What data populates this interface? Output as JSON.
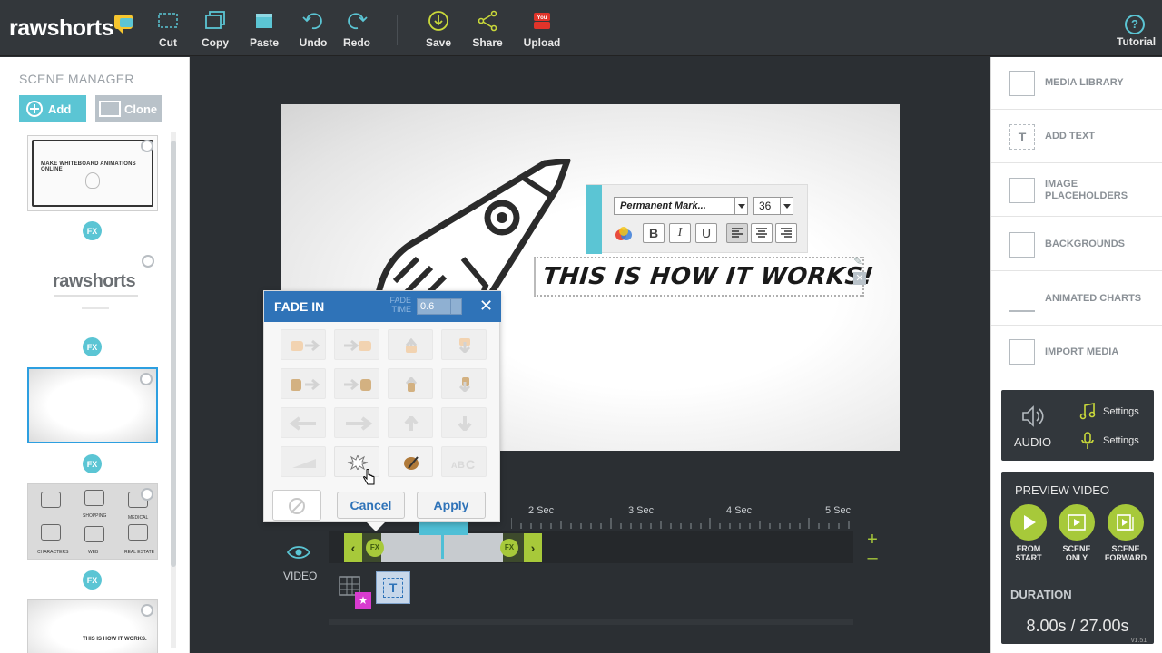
{
  "app": {
    "logo": "rawshorts"
  },
  "toolbar": {
    "cut": "Cut",
    "copy": "Copy",
    "paste": "Paste",
    "undo": "Undo",
    "redo": "Redo",
    "save": "Save",
    "share": "Share",
    "upload": "Upload",
    "tutorial": "Tutorial"
  },
  "scene_manager": {
    "title": "SCENE MANAGER",
    "add": "Add",
    "clone": "Clone",
    "fx": "FX",
    "thumb1_text": "MAKE WHITEBOARD ANIMATIONS ONLINE",
    "thumb2_logo": "rawshorts",
    "thumb4_labels": [
      "CHARACTERS",
      "SHOPPING",
      "MEDICAL",
      "WEB",
      "REAL ESTATE"
    ],
    "thumb5_text": "THIS IS HOW IT WORKS."
  },
  "text_toolbar": {
    "font": "Permanent Mark...",
    "size": "36",
    "bold": "B",
    "italic": "I",
    "underline": "U"
  },
  "canvas": {
    "text": "THIS IS HOW IT WORKS!"
  },
  "fade_dialog": {
    "title": "FADE IN",
    "time_label": "FADE TIME",
    "time_value": "0.6",
    "cancel": "Cancel",
    "apply": "Apply"
  },
  "timeline": {
    "ticks": [
      "2 Sec",
      "3 Sec",
      "4 Sec",
      "5 Sec"
    ],
    "fx": "FX",
    "video_label": "VIDEO",
    "layer_t": "T"
  },
  "right_panel": {
    "items": [
      "MEDIA LIBRARY",
      "ADD TEXT",
      "IMAGE PLACEHOLDERS",
      "BACKGROUNDS",
      "ANIMATED CHARTS",
      "IMPORT MEDIA"
    ],
    "audio": "AUDIO",
    "settings": "Settings",
    "preview_title": "PREVIEW VIDEO",
    "from_start": "FROM START",
    "scene_only": "SCENE ONLY",
    "scene_forward": "SCENE FORWARD",
    "duration_label": "DURATION",
    "duration_value": "8.00s / 27.00s"
  },
  "version": "v1.51",
  "colors": {
    "accent": "#5bc5d4",
    "green": "#a7c93a",
    "dialog_blue": "#2f73b8",
    "selection": "#2d9fe0"
  }
}
